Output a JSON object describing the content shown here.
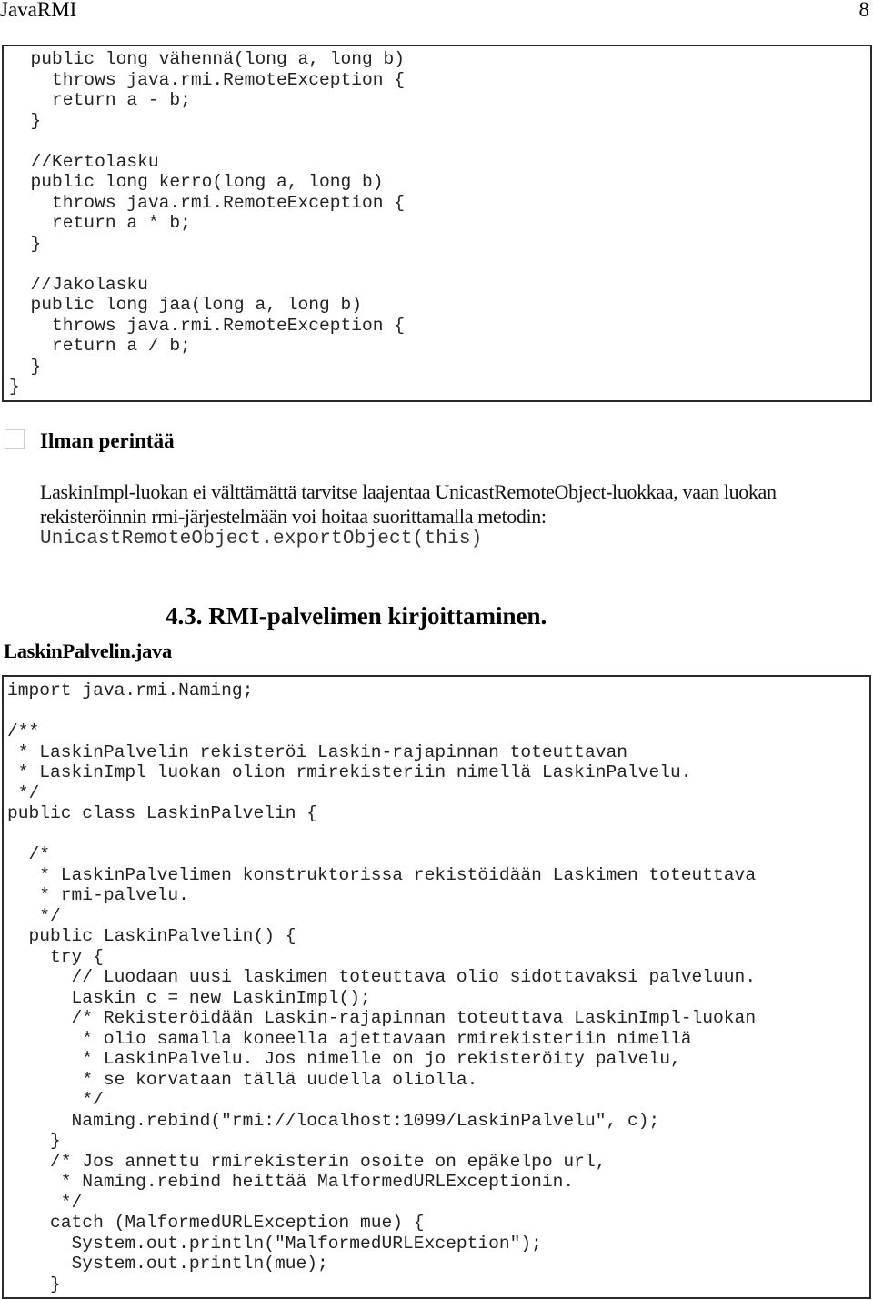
{
  "header": {
    "title": "JavaRMI",
    "page_number": "8"
  },
  "code_block_1": {
    "lines": [
      "  public long vähennä(long a, long b)",
      "    throws java.rmi.RemoteException {",
      "    return a - b;",
      "  }",
      "",
      "  //Kertolasku",
      "  public long kerro(long a, long b)",
      "    throws java.rmi.RemoteException {",
      "    return a * b;",
      "  }",
      "",
      "  //Jakolasku",
      "  public long jaa(long a, long b)",
      "    throws java.rmi.RemoteException {",
      "    return a / b;",
      "  }",
      "}"
    ]
  },
  "section": {
    "heading": "Ilman perintää",
    "paragraph_lines": [
      "LaskinImpl-luokan ei välttämättä tarvitse laajentaa UnicastRemoteObject-luokkaa, vaan luokan",
      "rekisteröinnin rmi-järjestelmään voi hoitaa suorittamalla metodin:"
    ],
    "code": "UnicastRemoteObject.exportObject(this)"
  },
  "chapter": {
    "heading": "4.3. RMI-palvelimen kirjoittaminen."
  },
  "file": {
    "name": "LaskinPalvelin.java"
  },
  "code_block_2": {
    "lines": [
      "import java.rmi.Naming;",
      "",
      "/**",
      " * LaskinPalvelin rekisteröi Laskin-rajapinnan toteuttavan",
      " * LaskinImpl luokan olion rmirekisteriin nimellä LaskinPalvelu.",
      " */",
      "public class LaskinPalvelin {",
      "",
      "  /*",
      "   * LaskinPalvelimen konstruktorissa rekistöidään Laskimen toteuttava",
      "   * rmi-palvelu.",
      "   */",
      "  public LaskinPalvelin() {",
      "    try {",
      "      // Luodaan uusi laskimen toteuttava olio sidottavaksi palveluun.",
      "      Laskin c = new LaskinImpl();",
      "      /* Rekisteröidään Laskin-rajapinnan toteuttava LaskinImpl-luokan",
      "       * olio samalla koneella ajettavaan rmirekisteriin nimellä",
      "       * LaskinPalvelu. Jos nimelle on jo rekisteröity palvelu,",
      "       * se korvataan tällä uudella oliolla.",
      "       */",
      "      Naming.rebind(\"rmi://localhost:1099/LaskinPalvelu\", c);",
      "    }",
      "    /* Jos annettu rmirekisterin osoite on epäkelpo url,",
      "     * Naming.rebind heittää MalformedURLExceptionin.",
      "     */",
      "    catch (MalformedURLException mue) {",
      "      System.out.println(\"MalformedURLException\");",
      "      System.out.println(mue);",
      "    }"
    ]
  }
}
